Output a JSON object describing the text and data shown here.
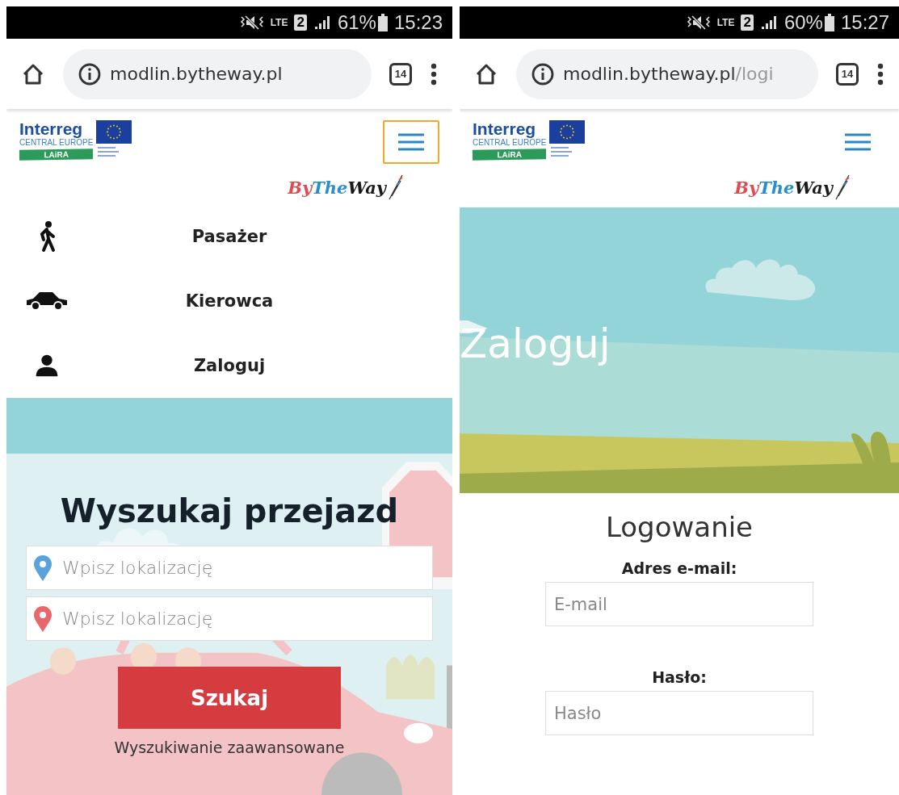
{
  "screens": [
    {
      "kind": "menu",
      "status_bar": {
        "network": "LTE",
        "sim": "2",
        "battery": "61%",
        "time": "15:23"
      },
      "browser": {
        "url_host": "modlin.bytheway.pl",
        "tab_count": "14"
      },
      "header": {
        "logo": {
          "wordmark": "Interreg",
          "program": "CENTRAL EUROPE",
          "project": "LAiRA"
        },
        "menu_button": {
          "focused": true
        },
        "brand": [
          "By",
          "The",
          "Way"
        ]
      },
      "menu": [
        {
          "kind": "walker",
          "label": "Pasażer"
        },
        {
          "kind": "car",
          "label": "Kierowca"
        },
        {
          "kind": "person",
          "label": "Zaloguj"
        }
      ],
      "search": {
        "title": "Wyszukaj przejazd",
        "fields": [
          {
            "placeholder": "Wpisz lokalizację",
            "color": "#5aa2dc"
          },
          {
            "placeholder": "Wpisz lokalizację",
            "color": "#e8676b"
          }
        ],
        "button": "Szukaj",
        "advanced_link": "Wyszukiwanie zaawansowane"
      }
    },
    {
      "kind": "login",
      "status_bar": {
        "network": "LTE",
        "sim": "2",
        "battery": "60%",
        "time": "15:27"
      },
      "browser": {
        "url_host": "modlin.bytheway.pl",
        "url_path": "/logi",
        "tab_count": "14"
      },
      "header": {
        "logo": {
          "wordmark": "Interreg",
          "program": "CENTRAL EUROPE",
          "project": "LAiRA"
        },
        "menu_button": {
          "focused": false
        },
        "brand": [
          "By",
          "The",
          "Way"
        ]
      },
      "hero": {
        "title": "Zaloguj"
      },
      "login": {
        "title": "Logowanie",
        "fields": [
          {
            "label": "Adres e-mail:",
            "placeholder": "E-mail"
          },
          {
            "label": "Hasło:",
            "placeholder": "Hasło"
          }
        ]
      }
    }
  ]
}
